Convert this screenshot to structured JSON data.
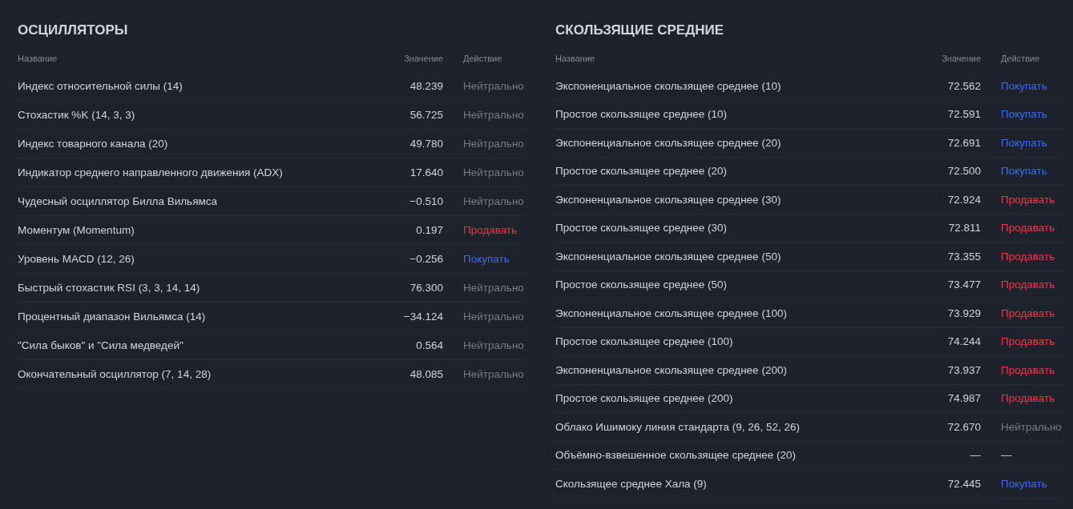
{
  "panels": [
    {
      "title": "ОСЦИЛЛЯТОРЫ",
      "columns": [
        "Название",
        "Значение",
        "Действие"
      ],
      "rows": [
        {
          "name": "Индекс относительной силы (14)",
          "value": "48.239",
          "action": "Нейтрально",
          "kind": "neutral"
        },
        {
          "name": "Стохастик %K (14, 3, 3)",
          "value": "56.725",
          "action": "Нейтрально",
          "kind": "neutral"
        },
        {
          "name": "Индекс товарного канала (20)",
          "value": "49.780",
          "action": "Нейтрально",
          "kind": "neutral"
        },
        {
          "name": "Индикатор среднего направленного движения (ADX)",
          "value": "17.640",
          "action": "Нейтрально",
          "kind": "neutral"
        },
        {
          "name": "Чудесный осциллятор Билла Вильямса",
          "value": "−0.510",
          "action": "Нейтрально",
          "kind": "neutral"
        },
        {
          "name": "Моментум (Momentum)",
          "value": "0.197",
          "action": "Продавать",
          "kind": "sell"
        },
        {
          "name": "Уровень MACD (12, 26)",
          "value": "−0.256",
          "action": "Покупать",
          "kind": "buy"
        },
        {
          "name": "Быстрый стохастик RSI (3, 3, 14, 14)",
          "value": "76.300",
          "action": "Нейтрально",
          "kind": "neutral"
        },
        {
          "name": "Процентный диапазон Вильямса (14)",
          "value": "−34.124",
          "action": "Нейтрально",
          "kind": "neutral"
        },
        {
          "name": "\"Сила быков\" и \"Сила медведей\"",
          "value": "0.564",
          "action": "Нейтрально",
          "kind": "neutral"
        },
        {
          "name": "Окончательный осциллятор (7, 14, 28)",
          "value": "48.085",
          "action": "Нейтрально",
          "kind": "neutral"
        }
      ]
    },
    {
      "title": "СКОЛЬЗЯЩИЕ СРЕДНИЕ",
      "columns": [
        "Название",
        "Значение",
        "Действие"
      ],
      "rows": [
        {
          "name": "Экспоненциальное скользящее среднее (10)",
          "value": "72.562",
          "action": "Покупать",
          "kind": "buy"
        },
        {
          "name": "Простое скользящее среднее (10)",
          "value": "72.591",
          "action": "Покупать",
          "kind": "buy"
        },
        {
          "name": "Экспоненциальное скользящее среднее (20)",
          "value": "72.691",
          "action": "Покупать",
          "kind": "buy"
        },
        {
          "name": "Простое скользящее среднее (20)",
          "value": "72.500",
          "action": "Покупать",
          "kind": "buy"
        },
        {
          "name": "Экспоненциальное скользящее среднее (30)",
          "value": "72.924",
          "action": "Продавать",
          "kind": "sell"
        },
        {
          "name": "Простое скользящее среднее (30)",
          "value": "72.811",
          "action": "Продавать",
          "kind": "sell"
        },
        {
          "name": "Экспоненциальное скользящее среднее (50)",
          "value": "73.355",
          "action": "Продавать",
          "kind": "sell"
        },
        {
          "name": "Простое скользящее среднее (50)",
          "value": "73.477",
          "action": "Продавать",
          "kind": "sell"
        },
        {
          "name": "Экспоненциальное скользящее среднее (100)",
          "value": "73.929",
          "action": "Продавать",
          "kind": "sell"
        },
        {
          "name": "Простое скользящее среднее (100)",
          "value": "74.244",
          "action": "Продавать",
          "kind": "sell"
        },
        {
          "name": "Экспоненциальное скользящее среднее (200)",
          "value": "73.937",
          "action": "Продавать",
          "kind": "sell"
        },
        {
          "name": "Простое скользящее среднее (200)",
          "value": "74.987",
          "action": "Продавать",
          "kind": "sell"
        },
        {
          "name": "Облако Ишимоку линия стандарта (9, 26, 52, 26)",
          "value": "72.670",
          "action": "Нейтрально",
          "kind": "neutral"
        },
        {
          "name": "Объёмно-взвешенное скользящее среднее (20)",
          "value": "—",
          "action": "—",
          "kind": "none"
        },
        {
          "name": "Скользящее среднее Хала (9)",
          "value": "72.445",
          "action": "Покупать",
          "kind": "buy"
        }
      ]
    }
  ]
}
